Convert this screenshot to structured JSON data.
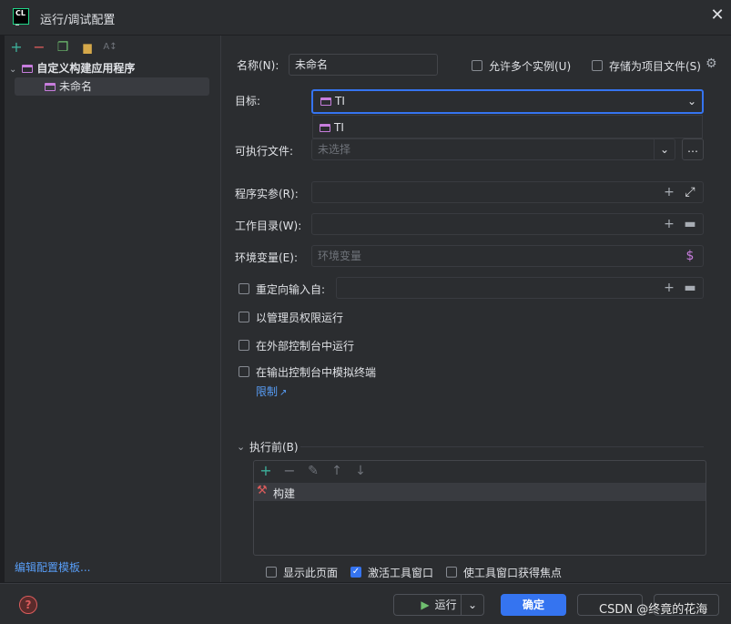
{
  "window": {
    "title": "运行/调试配置",
    "close_glyph": "✕"
  },
  "left": {
    "toolbar": [
      {
        "name": "add-icon",
        "glyph": "+",
        "color": "#3daf9a"
      },
      {
        "name": "remove-icon",
        "glyph": "−",
        "color": "#db5c5c"
      },
      {
        "name": "copy-icon",
        "glyph": "❐",
        "color": "#6fbf6f"
      },
      {
        "name": "folder-icon",
        "glyph": "▆",
        "color": "#d5a84a"
      },
      {
        "name": "sort-icon",
        "glyph": "A↕",
        "color": "#6f737a"
      }
    ],
    "tree": {
      "group_label": "自定义构建应用程序",
      "item_label": "未命名"
    },
    "edit_templates_link": "编辑配置模板..."
  },
  "form": {
    "name_label": "名称(N):",
    "name_value": "未命名",
    "allow_multiple_label": "允许多个实例(U)",
    "store_as_file_label": "存储为项目文件(S)",
    "target_label": "目标:",
    "target_value": "TI",
    "target_option": "TI",
    "executable_label": "可执行文件:",
    "executable_placeholder": "未选择",
    "program_args_label": "程序实参(R):",
    "working_dir_label": "工作目录(W):",
    "env_vars_label": "环境变量(E):",
    "env_vars_placeholder": "环境变量",
    "redirect_label": "重定向输入自:",
    "run_admin_label": "以管理员权限运行",
    "external_console_label": "在外部控制台中运行",
    "emulate_terminal_label": "在输出控制台中模拟终端",
    "limits_link": "限制"
  },
  "before_launch": {
    "header": "执行前(B)",
    "task_label": "构建"
  },
  "options": {
    "show_page_label": "显示此页面",
    "activate_tool_window_label": "激活工具窗口",
    "focus_tool_window_label": "使工具窗口获得焦点"
  },
  "footer": {
    "run_label": "运行",
    "ok_label": "确定",
    "watermark": "CSDN @终竟的花海"
  },
  "colors": {
    "accent": "#3574f0",
    "config_icon": "#c77ddd",
    "add_green": "#3daf9a"
  }
}
